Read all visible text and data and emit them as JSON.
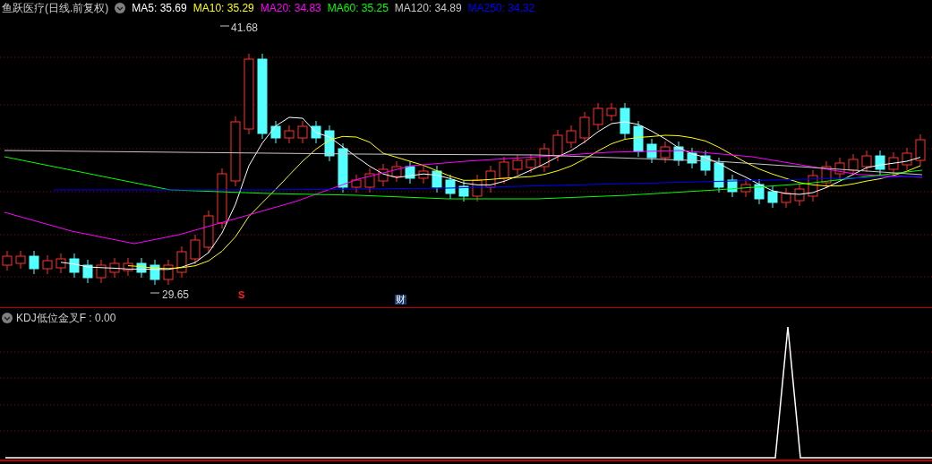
{
  "header": {
    "title": "鱼跃医疗(日线.前复权)",
    "indicators": [
      {
        "label": "MA5: 35.69",
        "color": "#ffffff"
      },
      {
        "label": "MA10: 35.29",
        "color": "#ffff00"
      },
      {
        "label": "MA20: 34.83",
        "color": "#ff00ff"
      },
      {
        "label": "MA60: 35.25",
        "color": "#00ff00"
      },
      {
        "label": "MA120: 34.89",
        "color": "#c8c8c8"
      },
      {
        "label": "MA250: 34.32",
        "color": "#0000ff"
      }
    ]
  },
  "main_chart": {
    "high_label": "41.68",
    "low_label": "29.65",
    "markers": [
      {
        "kind": "signal",
        "text": "S"
      },
      {
        "kind": "finance",
        "text": "财"
      }
    ]
  },
  "indicator_pane": {
    "legend": "KDJ低位金叉F : 0.00"
  }
}
